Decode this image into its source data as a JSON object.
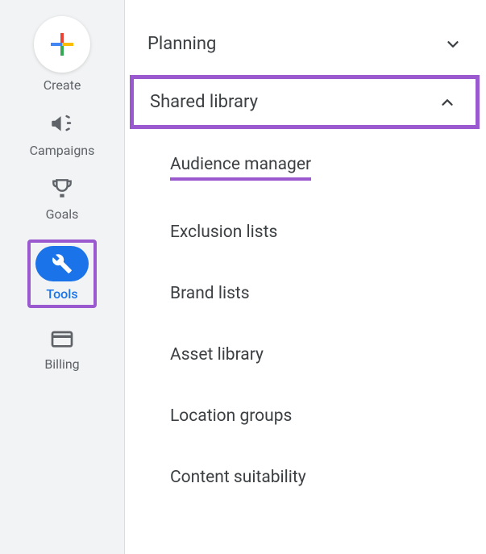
{
  "sidebar": {
    "create": "Create",
    "campaigns": "Campaigns",
    "goals": "Goals",
    "tools": "Tools",
    "billing": "Billing"
  },
  "menu": {
    "planning": "Planning",
    "shared_library": "Shared library",
    "sub": {
      "audience_manager": "Audience manager",
      "exclusion_lists": "Exclusion lists",
      "brand_lists": "Brand lists",
      "asset_library": "Asset library",
      "location_groups": "Location groups",
      "content_suitability": "Content suitability"
    }
  }
}
